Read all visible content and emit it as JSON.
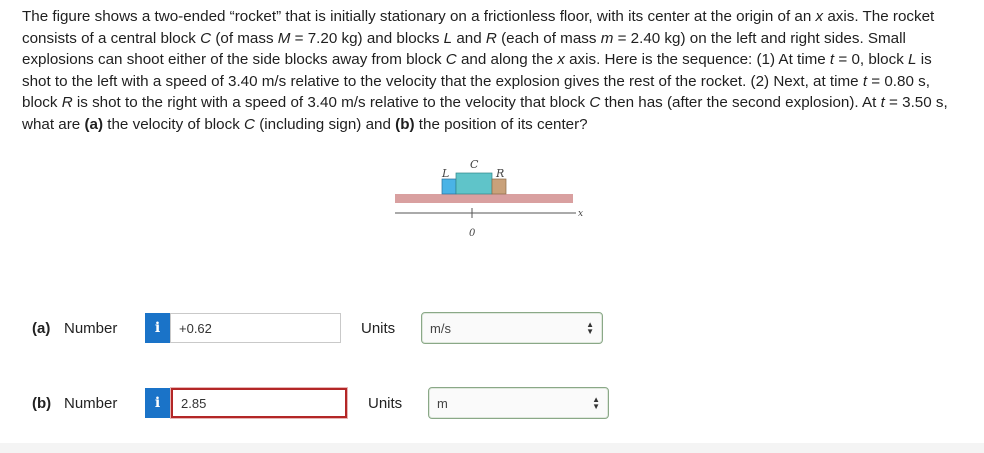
{
  "problem": {
    "t1": "The figure shows a two-ended “rocket” that is initially stationary on a frictionless floor, with its center at the origin of an ",
    "t2": "x",
    "t3": " axis. The rocket consists of a central block ",
    "t4": "C",
    "t5": " (of mass ",
    "t6": "M",
    "t7": " = 7.20 kg) and blocks ",
    "t8": "L",
    "t9": " and ",
    "t10": "R",
    "t11": " (each of mass ",
    "t12": "m",
    "t13": " = 2.40 kg) on the left and right sides. Small explosions can shoot either of the side blocks away from block ",
    "t14": "C",
    "t15": " and along the ",
    "t16": "x",
    "t17": " axis. Here is the sequence: (1) At time ",
    "t18": "t",
    "t19": " = 0, block ",
    "t20": "L",
    "t21": " is shot to the left with a speed of 3.40 m/s relative to the velocity that the explosion gives the rest of the rocket. (2) Next, at time ",
    "t22": "t",
    "t23": " = 0.80 s, block ",
    "t24": "R",
    "t25": " is shot to the right with a speed of 3.40 m/s relative to the velocity that block ",
    "t26": "C",
    "t27": " then has (after the second explosion). At ",
    "t28": "t",
    "t29": " = 3.50 s, what are ",
    "t30": "(a)",
    "t31": " the velocity of block ",
    "t32": "C",
    "t33": " (including sign) and ",
    "t34": "(b)",
    "t35": " the position of its center?"
  },
  "figure": {
    "label_L": "L",
    "label_C": "C",
    "label_R": "R",
    "label_x": "x",
    "label_zero": "0",
    "colors": {
      "floor": "#d9a0a0",
      "block_c": "#5fc4c9",
      "block_l": "#4ab3e6",
      "block_r": "#c9a17a"
    }
  },
  "answer_a": {
    "part": "(a)",
    "label": "Number",
    "info_icon": "i",
    "value": "+0.62",
    "units_label": "Units",
    "units_selected": "m/s"
  },
  "answer_b": {
    "part": "(b)",
    "label": "Number",
    "info_icon": "i",
    "value": "2.85",
    "units_label": "Units",
    "units_selected": "m"
  }
}
